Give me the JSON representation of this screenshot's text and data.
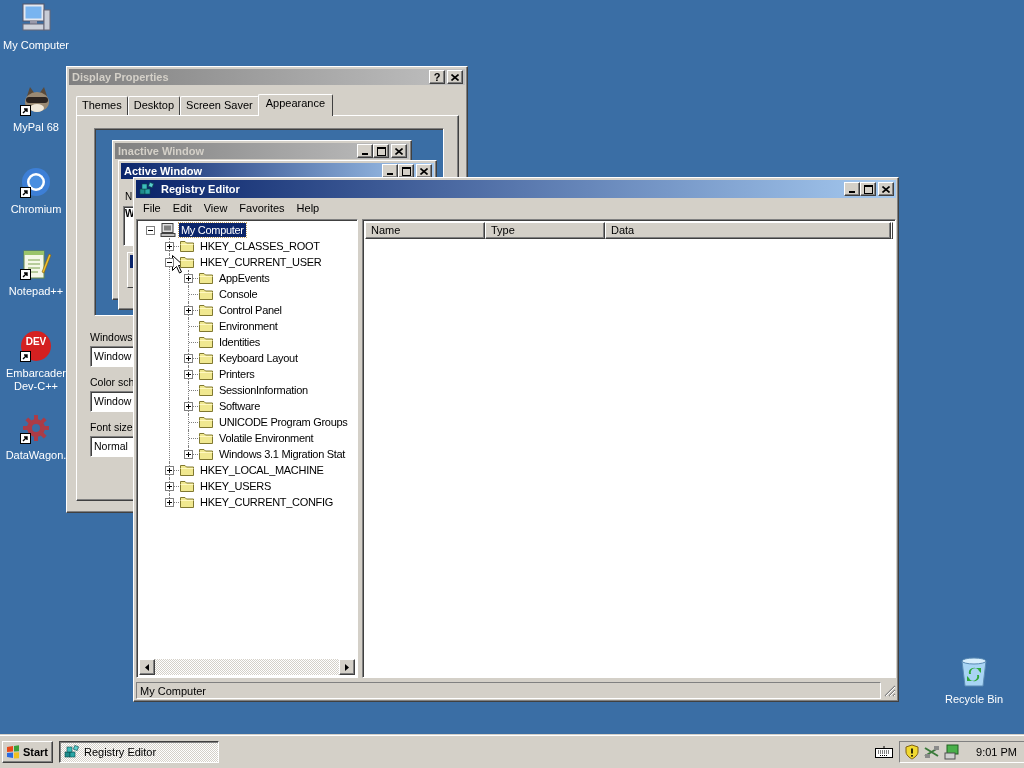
{
  "desktop_icons": [
    {
      "label": "My Computer",
      "kind": "computer",
      "shortcut": false
    },
    {
      "label": "MyPal 68",
      "kind": "animal",
      "shortcut": true
    },
    {
      "label": "Chromium",
      "kind": "browser",
      "shortcut": true
    },
    {
      "label": "Notepad++",
      "kind": "notepad",
      "shortcut": true
    },
    {
      "label": "Embarcader Dev-C++",
      "kind": "devcpp",
      "shortcut": true,
      "logo_text": "DEV"
    },
    {
      "label": "DataWagon.",
      "kind": "gear",
      "shortcut": true
    }
  ],
  "recycle_bin": {
    "label": "Recycle Bin",
    "kind": "recycle",
    "shortcut": false
  },
  "display_properties": {
    "title": "Display Properties",
    "active": false,
    "help_button": "?",
    "tabs": [
      {
        "label": "Themes",
        "selected": false
      },
      {
        "label": "Desktop",
        "selected": false
      },
      {
        "label": "Screen Saver",
        "selected": false
      },
      {
        "label": "Appearance",
        "selected": true
      }
    ],
    "preview": {
      "inactive_title": "Inactive Window",
      "active_title": "Active Window",
      "fragments": [
        "N",
        "W"
      ]
    },
    "fields": [
      {
        "label": "Windows",
        "value": "Window"
      },
      {
        "label": "Color sch",
        "value": "Window"
      },
      {
        "label": "Font size",
        "value": "Normal"
      }
    ]
  },
  "registry_editor": {
    "title": "Registry Editor",
    "active": true,
    "menu": [
      "File",
      "Edit",
      "View",
      "Favorites",
      "Help"
    ],
    "tree": {
      "label": "My Computer",
      "kind": "computer",
      "has_children": true,
      "expanded": true,
      "selected": true,
      "children": [
        {
          "label": "HKEY_CLASSES_ROOT",
          "kind": "folder",
          "has_children": true,
          "expanded": false,
          "selected": false
        },
        {
          "label": "HKEY_CURRENT_USER",
          "kind": "folder",
          "has_children": true,
          "expanded": true,
          "selected": false,
          "children": [
            {
              "label": "AppEvents",
              "kind": "folder",
              "has_children": true,
              "expanded": false,
              "selected": false
            },
            {
              "label": "Console",
              "kind": "folder",
              "has_children": false,
              "selected": false
            },
            {
              "label": "Control Panel",
              "kind": "folder",
              "has_children": true,
              "expanded": false,
              "selected": false
            },
            {
              "label": "Environment",
              "kind": "folder",
              "has_children": false,
              "selected": false
            },
            {
              "label": "Identities",
              "kind": "folder",
              "has_children": false,
              "selected": false
            },
            {
              "label": "Keyboard Layout",
              "kind": "folder",
              "has_children": true,
              "expanded": false,
              "selected": false
            },
            {
              "label": "Printers",
              "kind": "folder",
              "has_children": true,
              "expanded": false,
              "selected": false
            },
            {
              "label": "SessionInformation",
              "kind": "folder",
              "has_children": false,
              "selected": false
            },
            {
              "label": "Software",
              "kind": "folder",
              "has_children": true,
              "expanded": false,
              "selected": false
            },
            {
              "label": "UNICODE Program Groups",
              "kind": "folder",
              "has_children": false,
              "selected": false
            },
            {
              "label": "Volatile Environment",
              "kind": "folder",
              "has_children": false,
              "selected": false
            },
            {
              "label": "Windows 3.1 Migration Stat",
              "kind": "folder",
              "has_children": true,
              "expanded": false,
              "selected": false
            }
          ]
        },
        {
          "label": "HKEY_LOCAL_MACHINE",
          "kind": "folder",
          "has_children": true,
          "expanded": false,
          "selected": false
        },
        {
          "label": "HKEY_USERS",
          "kind": "folder",
          "has_children": true,
          "expanded": false,
          "selected": false
        },
        {
          "label": "HKEY_CURRENT_CONFIG",
          "kind": "folder",
          "has_children": true,
          "expanded": false,
          "selected": false
        }
      ]
    },
    "columns": [
      "Name",
      "Type",
      "Data"
    ],
    "status_bar": "My Computer"
  },
  "taskbar": {
    "start": "Start",
    "tasks": [
      {
        "label": "Registry Editor",
        "selected": true
      }
    ],
    "clock": "9:01 PM"
  }
}
